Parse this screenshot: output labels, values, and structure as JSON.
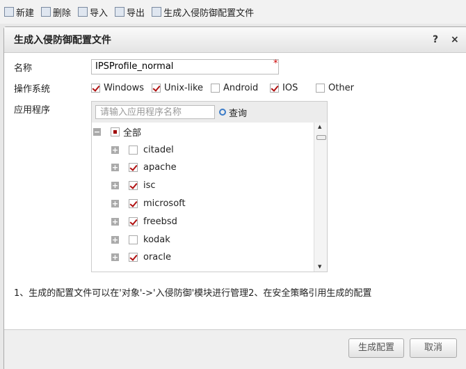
{
  "toolbar": {
    "items": [
      {
        "label": "新建",
        "icon": "new-icon"
      },
      {
        "label": "删除",
        "icon": "delete-icon"
      },
      {
        "label": "导入",
        "icon": "import-icon"
      },
      {
        "label": "导出",
        "icon": "export-icon"
      },
      {
        "label": "生成入侵防御配置文件",
        "icon": "generate-icon"
      }
    ]
  },
  "dialog": {
    "title": "生成入侵防御配置文件",
    "help": "?",
    "close": "×",
    "name_label": "名称",
    "name_value": "IPSProfile_normal",
    "required": "*",
    "os_label": "操作系统",
    "os": [
      {
        "label": "Windows",
        "checked": true
      },
      {
        "label": "Unix-like",
        "checked": true
      },
      {
        "label": "Android",
        "checked": false
      },
      {
        "label": "IOS",
        "checked": true
      },
      {
        "label": "Other",
        "checked": false
      }
    ],
    "app_label": "应用程序",
    "search_placeholder": "请输入应用程序名称",
    "search_button": "查询",
    "root": {
      "label": "全部",
      "state": "partial"
    },
    "apps": [
      {
        "label": "citadel",
        "checked": false
      },
      {
        "label": "apache",
        "checked": true
      },
      {
        "label": "isc",
        "checked": true
      },
      {
        "label": "microsoft",
        "checked": true
      },
      {
        "label": "freebsd",
        "checked": true
      },
      {
        "label": "kodak",
        "checked": false
      },
      {
        "label": "oracle",
        "checked": true
      }
    ],
    "note": "1、生成的配置文件可以在'对象'->'入侵防御'模块进行管理2、在安全策略引用生成的配置",
    "ok": "生成配置",
    "cancel": "取消"
  },
  "colors": {
    "check": "#b01010",
    "accent": "#3a7bc8"
  }
}
